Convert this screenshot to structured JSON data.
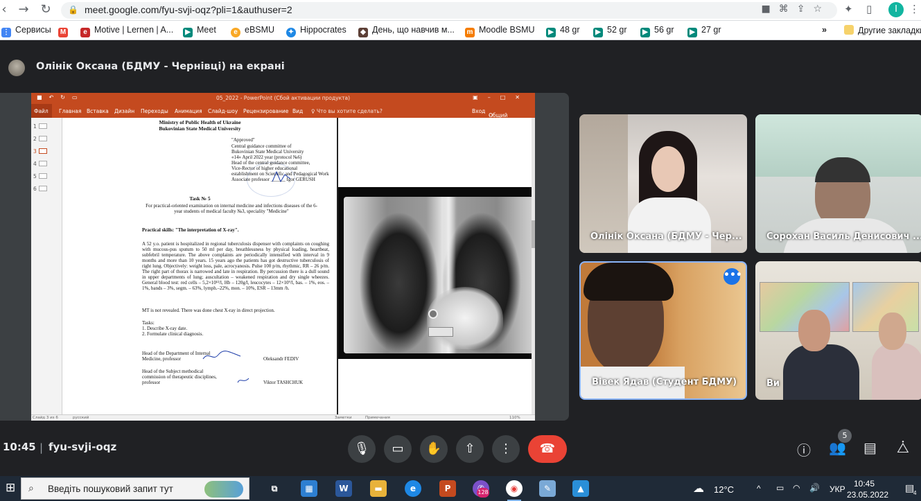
{
  "browser": {
    "url": "meet.google.com/fyu-svji-oqz?pli=1&authuser=2",
    "profile_initial": "I"
  },
  "bookmarks": {
    "items": [
      {
        "label": "Сервисы",
        "icon": "apps-grid-icon",
        "color": "#4285f4"
      },
      {
        "label": "",
        "icon": "gmail-icon",
        "color": "#ea4335"
      },
      {
        "label": "Motive | Lernen | A...",
        "icon": "motive-icon",
        "color": "#c62828"
      },
      {
        "label": "Meet",
        "icon": "meet-icon",
        "color": "#00897b"
      },
      {
        "label": "eBSMU",
        "icon": "ebsmu-icon",
        "color": "#f9a825"
      },
      {
        "label": "Hippocrates",
        "icon": "hippocrates-icon",
        "color": "#1e88e5"
      },
      {
        "label": "День, що навчив м...",
        "icon": "cat-icon",
        "color": "#5d4037"
      },
      {
        "label": "Moodle BSMU",
        "icon": "moodle-icon",
        "color": "#f57c00"
      },
      {
        "label": "48 gr",
        "icon": "meet-icon",
        "color": "#00897b"
      },
      {
        "label": "52 gr",
        "icon": "meet-icon",
        "color": "#00897b"
      },
      {
        "label": "56 gr",
        "icon": "meet-icon",
        "color": "#00897b"
      },
      {
        "label": "27 gr",
        "icon": "meet-icon",
        "color": "#00897b"
      }
    ],
    "overflow": "»",
    "other_bookmarks": "Другие закладки"
  },
  "meet": {
    "presenter_text": "Олінік Оксана (БДМУ - Чернівці) на екрані",
    "time": "10:45",
    "separator": "|",
    "meeting_code": "fyu-svji-oqz",
    "people_count": "5",
    "tiles": [
      {
        "name": "Олінік Оксана (БДМУ - Чер..."
      },
      {
        "name": "Сорохан Василь Денисович ..."
      },
      {
        "name": "Вівек Ядав (Студент БДМУ)"
      },
      {
        "name": "Ви"
      }
    ],
    "more_options": "•••"
  },
  "ppt": {
    "title": "05_2022 - PowerPoint (Сбой активации продукта)",
    "ribbon": [
      "Файл",
      "Главная",
      "Вставка",
      "Дизайн",
      "Переходы",
      "Анимация",
      "Слайд-шоу",
      "Рецензирование",
      "Вид",
      "♀ Что вы хотите сделать?"
    ],
    "signin": "Вход",
    "share": "Общий доступ",
    "slide_numbers": [
      "1",
      "2",
      "3",
      "4",
      "5",
      "6"
    ],
    "status_left": "Слайд 3 из 6",
    "status_lang": "русский",
    "status_notes": "Заметки",
    "status_comments": "Примечания",
    "zoom": "110%"
  },
  "doc": {
    "ministry": "Ministry of Public Health of Ukraine",
    "university": "Bukovinian State Medical University",
    "approval": [
      "\"Approved\"",
      "Central guidance committee of",
      "Bukovinian State Medical University",
      "«14» April 2022 year (protocol №6)",
      "Head of the central guidance committee,",
      "Vice-Rector of higher educational",
      "establishment on Scientific and Pedagogical Work",
      "Associate professor ______ Igor GERUSH"
    ],
    "task_title": "Task № 5",
    "purpose": "For practical-oriented examination on internal medicine and infections diseases of the 6-year students of medical faculty №3, speciality \"Medicine\"",
    "skills": "Practical skills: \"The interpretation of X-ray\".",
    "case": "A 52 y.o. patient is hospitalized in regional tuberculosis dispenser with complaints on coughing with mucous-pus sputum to 50 ml per day, breathlessness by physical loading, heartbeat, subfebril temperature. The above complaints are periodically intensified with interval in 9 months and more than 10 years. 15 years ago the patients has got destructive tuberculosis of right lung. Objectively: weight loss, pale, acrocyanosis. Pulse 100 p/m, rhythmic, RR – 26 p/m. The right part of thorax is narrowed and late in respiration. By percussion there is a dull sound in upper departments of lung; auscultation – weakened respiration and dry single wheezes. General blood test: red cells – 5,2×10¹²/l, Hb – 120g/l, leucocytes – 12×10⁹/l, bas. – 1%, eos. – 1%, bands – 3%, segm. – 63%, lymph.–22%, mon. – 10%, ESR – 13mm /h.",
    "mt": "MT is not revealed. There was done chest X-ray in direct projection.",
    "tasks_head": "Tasks:",
    "tasks": [
      "1. Describe X-ray date.",
      "2. Formulate clinical diagnosis."
    ],
    "sign1_role": [
      "Head of the Department of Internal",
      "Medicine, professor"
    ],
    "sign1_name": "Oleksandr FEDIV",
    "sign2_role": [
      "Head of the Subject methodical",
      "commission of therapeutic disciplines,",
      "professor"
    ],
    "sign2_name": "Viktor TASHCHUK"
  },
  "taskbar": {
    "search_placeholder": "Введіть пошуковий запит тут",
    "weather": "12°C",
    "lang": "УКР",
    "clock_time": "10:45",
    "clock_date": "23.05.2022",
    "viber_badge": "128",
    "notif_count": "4"
  },
  "colors": {
    "meet_bg": "#202124",
    "end_call": "#ea4335",
    "ppt_accent": "#c44a1f",
    "active_tile_border": "#8ab4f8"
  }
}
